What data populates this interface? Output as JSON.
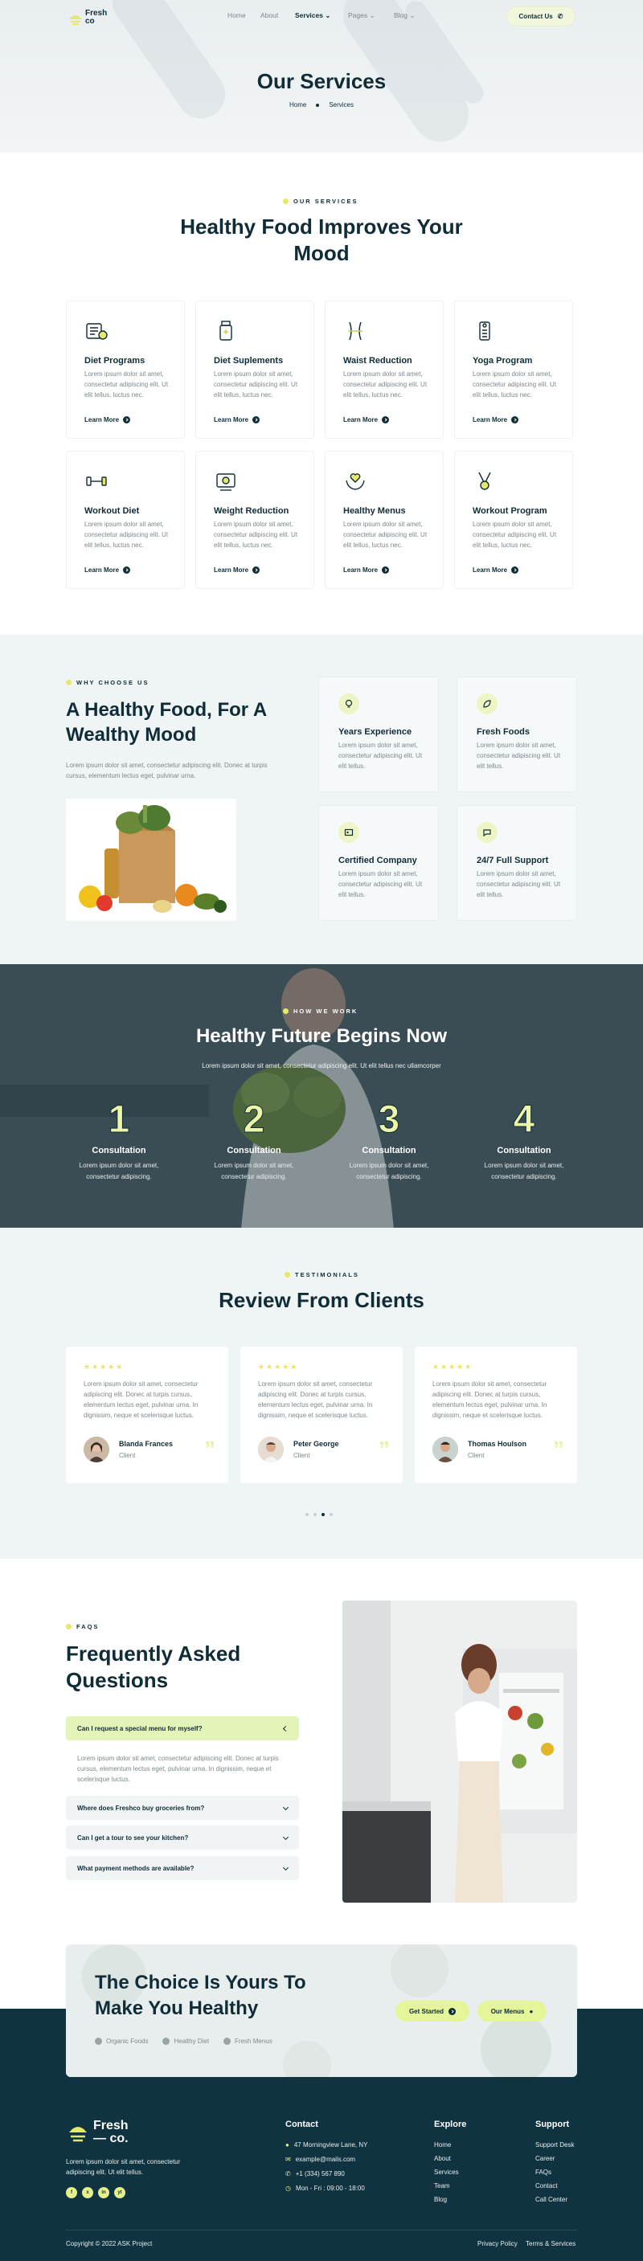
{
  "header": {
    "logo": {
      "line1": "Fresh",
      "line2": "co"
    },
    "nav": [
      {
        "label": "Home"
      },
      {
        "label": "About"
      },
      {
        "label": "Services"
      },
      {
        "label": "Pages"
      },
      {
        "label": "Blog"
      }
    ],
    "contact_label": "Contact Us"
  },
  "hero": {
    "title": "Our Services",
    "breadcrumb": [
      "Home",
      "Services"
    ]
  },
  "services": {
    "eyebrow": "OUR SERVICES",
    "title_line1": "Healthy Food Improves Your",
    "title_line2": "Mood",
    "cards": [
      {
        "icon": "diet-programs-icon",
        "title": "Diet Programs",
        "desc": "Lorem ipsum dolor sit amet, consectetur adipiscing elit. Ut elit tellus, luctus nec.",
        "link": "Learn More"
      },
      {
        "icon": "supplements-icon",
        "title": "Diet Suplements",
        "desc": "Lorem ipsum dolor sit amet, consectetur adipiscing elit. Ut elit tellus, luctus nec.",
        "link": "Learn More"
      },
      {
        "icon": "waist-icon",
        "title": "Waist Reduction",
        "desc": "Lorem ipsum dolor sit amet, consectetur adipiscing elit. Ut elit tellus, luctus nec.",
        "link": "Learn More"
      },
      {
        "icon": "yoga-icon",
        "title": "Yoga Program",
        "desc": "Lorem ipsum dolor sit amet, consectetur adipiscing elit. Ut elit tellus, luctus nec.",
        "link": "Learn More"
      },
      {
        "icon": "dumbbell-icon",
        "title": "Workout Diet",
        "desc": "Lorem ipsum dolor sit amet, consectetur adipiscing elit. Ut elit tellus, luctus nec.",
        "link": "Learn More"
      },
      {
        "icon": "scale-icon",
        "title": "Weight Reduction",
        "desc": "Lorem ipsum dolor sit amet, consectetur adipiscing elit. Ut elit tellus, luctus nec.",
        "link": "Learn More"
      },
      {
        "icon": "heart-hands-icon",
        "title": "Healthy Menus",
        "desc": "Lorem ipsum dolor sit amet, consectetur adipiscing elit. Ut elit tellus, luctus nec.",
        "link": "Learn More"
      },
      {
        "icon": "gripper-icon",
        "title": "Workout Program",
        "desc": "Lorem ipsum dolor sit amet, consectetur adipiscing elit. Ut elit tellus, luctus nec.",
        "link": "Learn More"
      }
    ]
  },
  "why": {
    "eyebrow": "WHY CHOOSE US",
    "title_line1": "A Healthy Food, For A",
    "title_line2": "Wealthy Mood",
    "desc": "Lorem ipsum dolor sit amet, consectetur adipiscing elit. Donec at turpis cursus, elementum lectus eget, pulvinar urna.",
    "cards": [
      {
        "icon": "bulb-icon",
        "title": "Years Experience",
        "desc": "Lorem ipsum dolor sit amet, consectetur adipiscing elit. Ut elit tellus."
      },
      {
        "icon": "leaf-icon",
        "title": "Fresh Foods",
        "desc": "Lorem ipsum dolor sit amet, consectetur adipiscing elit. Ut elit tellus."
      },
      {
        "icon": "certificate-icon",
        "title": "Certified Company",
        "desc": "Lorem ipsum dolor sit amet, consectetur adipiscing elit. Ut elit tellus."
      },
      {
        "icon": "support-chat-icon",
        "title": "24/7 Full Support",
        "desc": "Lorem ipsum dolor sit amet, consectetur adipiscing elit. Ut elit tellus."
      }
    ]
  },
  "process": {
    "eyebrow": "HOW WE WORK",
    "title": "Healthy Future Begins Now",
    "desc": "Lorem ipsum dolor sit amet, consectetur adipiscing elit. Ut elit tellus nec ullamcorper",
    "steps": [
      {
        "num": "1",
        "title": "Consultation",
        "desc": "Lorem ipsum dolor sit amet, consectetur adipiscing."
      },
      {
        "num": "2",
        "title": "Consultation",
        "desc": "Lorem ipsum dolor sit amet, consectetur adipiscing."
      },
      {
        "num": "3",
        "title": "Consultation",
        "desc": "Lorem ipsum dolor sit amet, consectetur adipiscing."
      },
      {
        "num": "4",
        "title": "Consultation",
        "desc": "Lorem ipsum dolor sit amet, consectetur adipiscing."
      }
    ]
  },
  "testimonials": {
    "eyebrow": "TESTIMONIALS",
    "title": "Review From Clients",
    "stars": "★★★★★",
    "quote_mark": "”",
    "items": [
      {
        "quote": "Lorem ipsum dolor sit amet, consectetur adipiscing elit. Donec at turpis cursus, elementum lectus eget, pulvinar urna. In dignissim, neque et scelerisque luctus.",
        "name": "Blanda Frances",
        "role": "Client"
      },
      {
        "quote": "Lorem ipsum dolor sit amet, consectetur adipiscing elit. Donec at turpis cursus, elementum lectus eget, pulvinar urna. In dignissim, neque et scelerisque luctus.",
        "name": "Peter George",
        "role": "Client"
      },
      {
        "quote": "Lorem ipsum dolor sit amet, consectetur adipiscing elit. Donec at turpis cursus, elementum lectus eget, pulvinar urna. In dignissim, neque et scelerisque luctus.",
        "name": "Thomas Houlson",
        "role": "Client"
      }
    ],
    "active_dot": 3
  },
  "faq": {
    "eyebrow": "FAQS",
    "title_line1": "Frequently Asked",
    "title_line2": "Questions",
    "items": [
      {
        "q": "Can I request a special menu for myself?",
        "a": "Lorem ipsum dolor sit amet, consectetur adipiscing elit. Donec at turpis cursus, elementum lectus eget, pulvinar urna. In dignissim, neque et scelerisque luctus."
      },
      {
        "q": "Where does Freshco buy groceries from?"
      },
      {
        "q": "Can I get a tour to see your kitchen?"
      },
      {
        "q": "What payment methods are available?"
      }
    ]
  },
  "cta": {
    "title_line1": "The Choice Is Yours To",
    "title_line2": "Make You Healthy",
    "tags": [
      "Organic Foods",
      "Healthy Diet",
      "Fresh Menus"
    ],
    "btn_primary": "Get Started",
    "btn_secondary": "Our Menus"
  },
  "footer": {
    "logo": {
      "line1": "Fresh",
      "line2": "— co."
    },
    "desc": "Lorem ipsum dolor sit amet, consectetur adipiscing elit. Ut elit tellus.",
    "social": [
      "f",
      "x",
      "in",
      "yt"
    ],
    "contact": {
      "title": "Contact",
      "items": [
        "47 Morningview Lane, NY",
        "example@mails.com",
        "+1 (334) 567 890",
        "Mon - Fri : 09:00 - 18:00"
      ]
    },
    "explore": {
      "title": "Explore",
      "items": [
        "Home",
        "About",
        "Services",
        "Team",
        "Blog"
      ]
    },
    "support": {
      "title": "Support",
      "items": [
        "Support Desk",
        "Career",
        "FAQs",
        "Contact",
        "Call Center"
      ]
    },
    "copyright": "Copyright © 2022 ASK Project",
    "legal": [
      "Privacy Policy",
      "Terms & Services"
    ]
  },
  "colors": {
    "navy": "#0f2c37",
    "lime": "#e4f59a",
    "muted": "#7d878b"
  }
}
